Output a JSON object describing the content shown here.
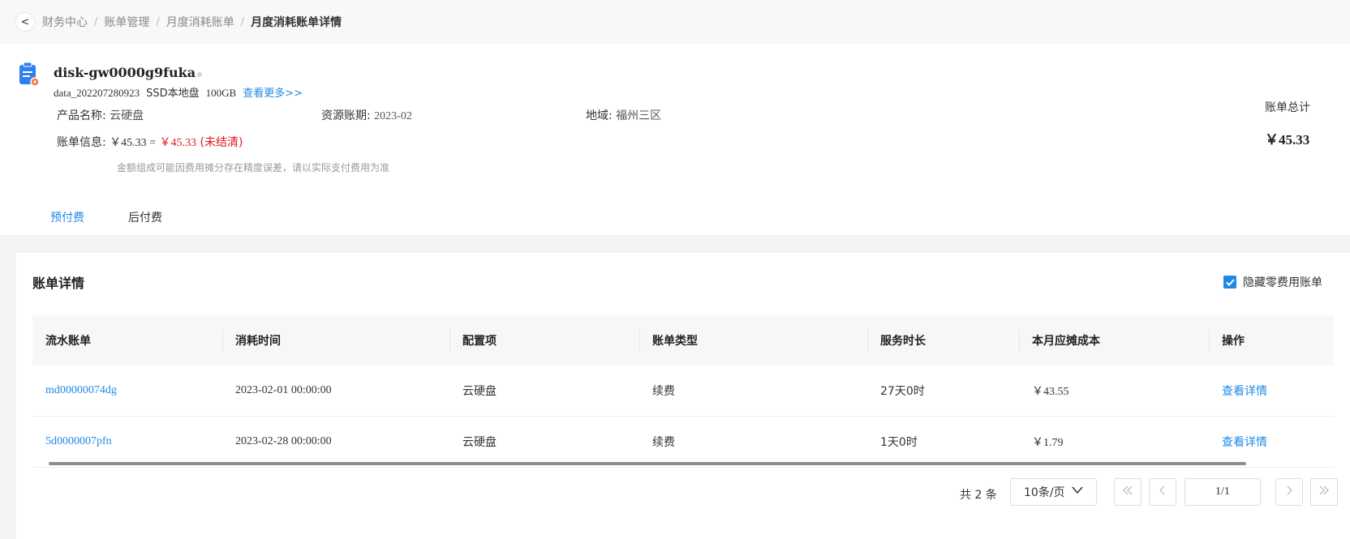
{
  "breadcrumb": {
    "back": "<",
    "items": [
      "财务中心",
      "账单管理",
      "月度消耗账单",
      "月度消耗账单详情"
    ]
  },
  "resource": {
    "name": "disk-gw0000g9fuka",
    "id": "data_202207280923",
    "type": "SSD本地盘",
    "size": "100GB",
    "more_link": "查看更多>>",
    "product_label": "产品名称:",
    "product_value": "云硬盘",
    "period_label": "资源账期:",
    "period_value": "2023-02",
    "region_label": "地域:",
    "region_value": "福州三区",
    "bill_label": "账单信息:",
    "bill_amount": "￥45.33 =",
    "bill_unpaid": "￥45.33",
    "bill_status": "(未结清)",
    "hint": "金额组成可能因费用摊分存在精度误差，请以实际支付费用为准"
  },
  "total": {
    "label": "账单总计",
    "value": "￥45.33"
  },
  "tabs": [
    "预付费",
    "后付费"
  ],
  "detail": {
    "title": "账单详情",
    "hide_zero_label": "隐藏零费用账单",
    "hide_zero_checked": true,
    "columns": [
      "流水账单",
      "消耗时间",
      "配置项",
      "账单类型",
      "服务时长",
      "本月应摊成本",
      "操作"
    ],
    "rows": [
      [
        "md00000074dg",
        "2023-02-01 00:00:00",
        "云硬盘",
        "续费",
        "27天0时",
        "￥43.55",
        "查看详情"
      ],
      [
        "5d0000007pfn",
        "2023-02-28 00:00:00",
        "云硬盘",
        "续费",
        "1天0时",
        "￥1.79",
        "查看详情"
      ]
    ]
  },
  "pagination": {
    "total_text": "共 2 条",
    "page_size": "10条/页",
    "page": "1/1"
  },
  "colors": {
    "accent": "#1f8ae6",
    "danger": "#e4161d"
  }
}
